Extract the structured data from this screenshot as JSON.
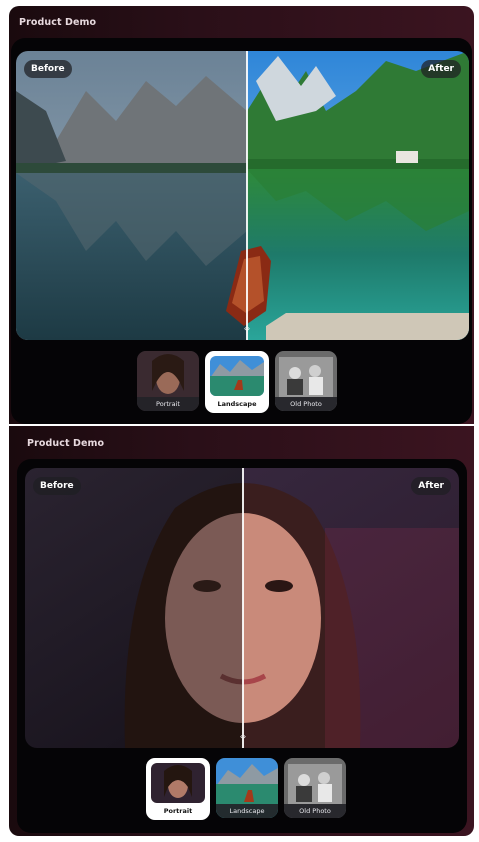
{
  "panels": [
    {
      "title": "Product Demo",
      "before_label": "Before",
      "after_label": "After",
      "selected": "Landscape",
      "thumbnails": [
        {
          "label": "Portrait",
          "icon": "portrait-thumbnail"
        },
        {
          "label": "Landscape",
          "icon": "landscape-thumbnail"
        },
        {
          "label": "Old Photo",
          "icon": "old-photo-thumbnail"
        }
      ]
    },
    {
      "title": "Product Demo",
      "before_label": "Before",
      "after_label": "After",
      "selected": "Portrait",
      "thumbnails": [
        {
          "label": "Portrait",
          "icon": "portrait-thumbnail"
        },
        {
          "label": "Landscape",
          "icon": "landscape-thumbnail"
        },
        {
          "label": "Old Photo",
          "icon": "old-photo-thumbnail"
        }
      ]
    }
  ],
  "colors": {
    "panel_bg_start": "#1a0a0e",
    "panel_bg_end": "#3b1420",
    "inner_bg": "#050406",
    "active_thumb": "#ffffff"
  }
}
